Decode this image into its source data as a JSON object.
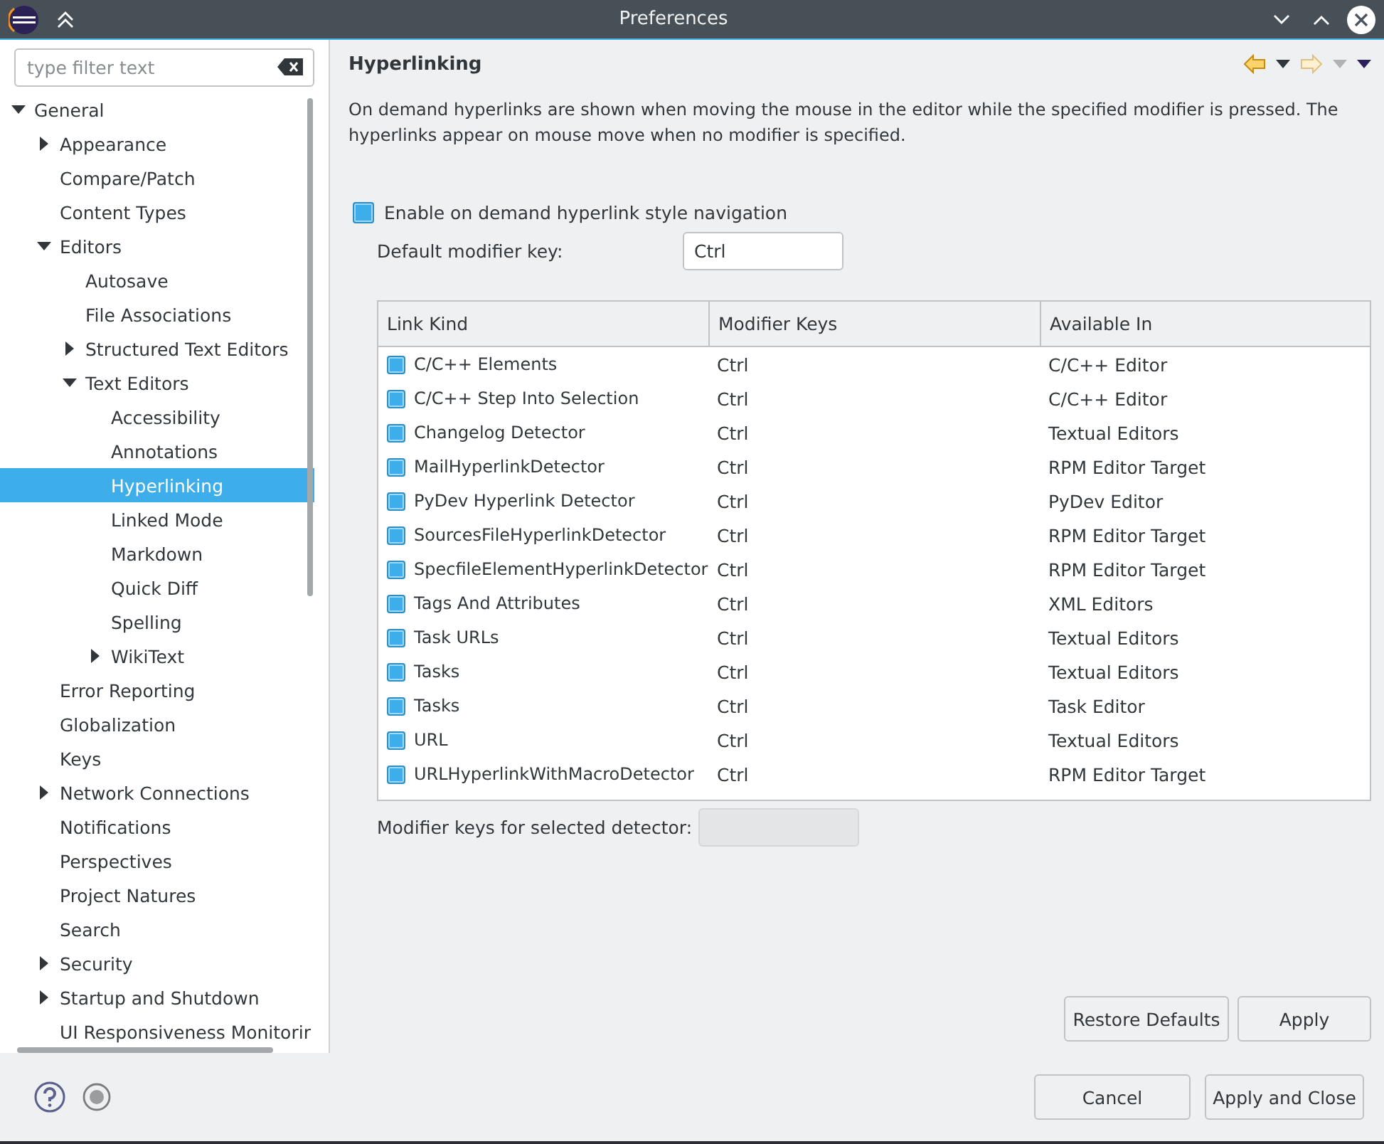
{
  "window": {
    "title": "Preferences"
  },
  "filter": {
    "placeholder": "type filter text"
  },
  "tree": [
    {
      "label": "General",
      "expanded": true,
      "selected": false,
      "children": [
        {
          "label": "Appearance",
          "expanded": false,
          "selected": false
        },
        {
          "label": "Compare/Patch",
          "selected": false
        },
        {
          "label": "Content Types",
          "selected": false
        },
        {
          "label": "Editors",
          "expanded": true,
          "selected": false,
          "children": [
            {
              "label": "Autosave",
              "selected": false
            },
            {
              "label": "File Associations",
              "selected": false
            },
            {
              "label": "Structured Text Editors",
              "expanded": false,
              "selected": false
            },
            {
              "label": "Text Editors",
              "expanded": true,
              "selected": false,
              "children": [
                {
                  "label": "Accessibility",
                  "selected": false
                },
                {
                  "label": "Annotations",
                  "selected": false
                },
                {
                  "label": "Hyperlinking",
                  "selected": true
                },
                {
                  "label": "Linked Mode",
                  "selected": false
                },
                {
                  "label": "Markdown",
                  "selected": false
                },
                {
                  "label": "Quick Diff",
                  "selected": false
                },
                {
                  "label": "Spelling",
                  "selected": false
                },
                {
                  "label": "WikiText",
                  "expanded": false,
                  "selected": false
                }
              ]
            }
          ]
        },
        {
          "label": "Error Reporting",
          "selected": false
        },
        {
          "label": "Globalization",
          "selected": false
        },
        {
          "label": "Keys",
          "selected": false
        },
        {
          "label": "Network Connections",
          "expanded": false,
          "selected": false
        },
        {
          "label": "Notifications",
          "selected": false
        },
        {
          "label": "Perspectives",
          "selected": false
        },
        {
          "label": "Project Natures",
          "selected": false
        },
        {
          "label": "Search",
          "selected": false
        },
        {
          "label": "Security",
          "expanded": false,
          "selected": false
        },
        {
          "label": "Startup and Shutdown",
          "expanded": false,
          "selected": false
        },
        {
          "label": "UI Responsiveness Monitorir",
          "selected": false
        }
      ]
    }
  ],
  "page": {
    "title": "Hyperlinking",
    "description": "On demand hyperlinks are shown when moving the mouse in the editor while the specified modifier is pressed. The hyperlinks appear on mouse move when no modifier is specified.",
    "enable": {
      "label": "Enable on demand hyperlink style navigation",
      "checked": true
    },
    "default_modifier": {
      "label": "Default modifier key:",
      "value": "Ctrl"
    },
    "table": {
      "columns": [
        "Link Kind",
        "Modifier Keys",
        "Available In"
      ],
      "rows": [
        {
          "kind": "C/C++ Elements",
          "modifier": "Ctrl",
          "available": "C/C++ Editor",
          "checked": true
        },
        {
          "kind": "C/C++ Step Into Selection",
          "modifier": "Ctrl",
          "available": "C/C++ Editor",
          "checked": true
        },
        {
          "kind": "Changelog Detector",
          "modifier": "Ctrl",
          "available": "Textual Editors",
          "checked": true
        },
        {
          "kind": "MailHyperlinkDetector",
          "modifier": "Ctrl",
          "available": "RPM Editor Target",
          "checked": true
        },
        {
          "kind": "PyDev Hyperlink Detector",
          "modifier": "Ctrl",
          "available": "PyDev Editor",
          "checked": true
        },
        {
          "kind": "SourcesFileHyperlinkDetector",
          "modifier": "Ctrl",
          "available": "RPM Editor Target",
          "checked": true
        },
        {
          "kind": "SpecfileElementHyperlinkDetector",
          "modifier": "Ctrl",
          "available": "RPM Editor Target",
          "checked": true
        },
        {
          "kind": "Tags And Attributes",
          "modifier": "Ctrl",
          "available": "XML Editors",
          "checked": true
        },
        {
          "kind": "Task URLs",
          "modifier": "Ctrl",
          "available": "Textual Editors",
          "checked": true
        },
        {
          "kind": "Tasks",
          "modifier": "Ctrl",
          "available": "Textual Editors",
          "checked": true
        },
        {
          "kind": "Tasks",
          "modifier": "Ctrl",
          "available": "Task Editor",
          "checked": true
        },
        {
          "kind": "URL",
          "modifier": "Ctrl",
          "available": "Textual Editors",
          "checked": true
        },
        {
          "kind": "URLHyperlinkWithMacroDetector",
          "modifier": "Ctrl",
          "available": "RPM Editor Target",
          "checked": true
        }
      ]
    },
    "selected_modifier": {
      "label": "Modifier keys for selected detector:"
    },
    "buttons": [
      "Restore Defaults",
      "Apply"
    ]
  },
  "footer": {
    "buttons": [
      "Cancel",
      "Apply and Close"
    ]
  }
}
